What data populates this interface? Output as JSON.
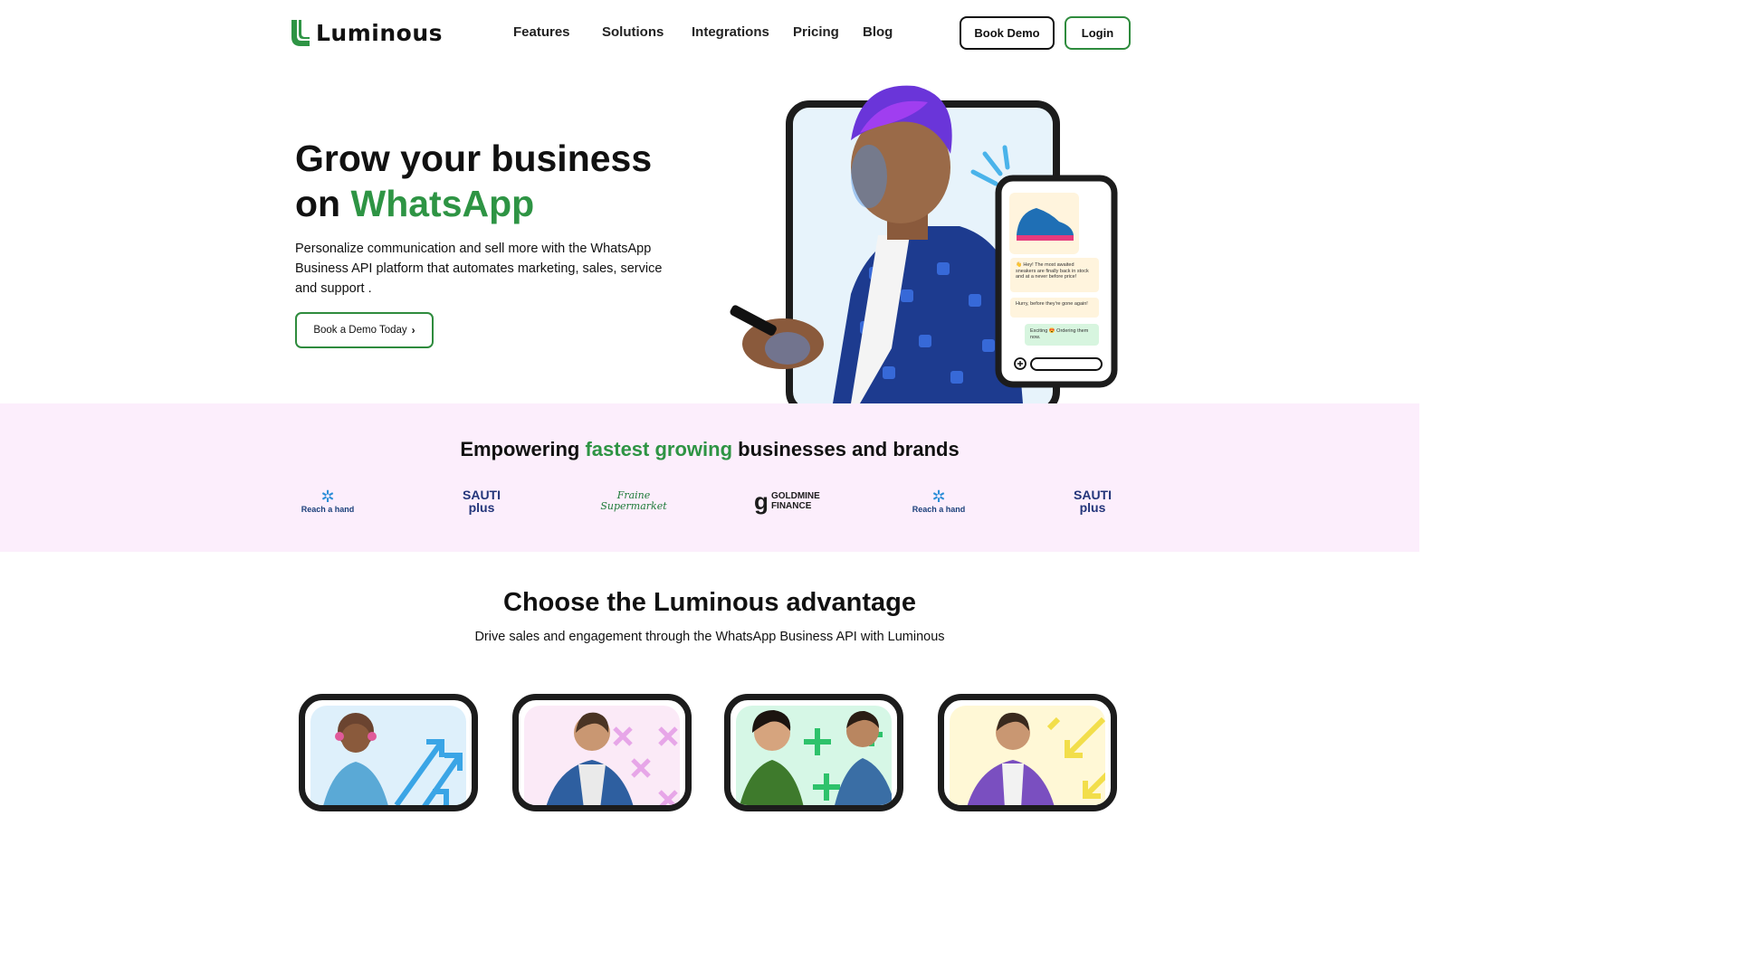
{
  "brand": {
    "name": "Luminous",
    "accent": "#2e9444"
  },
  "nav": {
    "links": [
      "Features",
      "Solutions",
      "Integrations",
      "Pricing",
      "Blog"
    ],
    "book_demo": "Book Demo",
    "login": "Login"
  },
  "hero": {
    "title_line1": "Grow your business",
    "title_on": "on",
    "title_highlight": "WhatsApp",
    "subtitle": "Personalize communication and sell more with the WhatsApp Business API platform that automates marketing, sales, service and support .",
    "cta": "Book a Demo Today",
    "chat": {
      "msg1": "👋 Hey! The most awaited sneakers are finally back in stock and at a never before price!",
      "msg2": "Hurry, before they're gone again!",
      "reply": "Exciting 😍 Ordering them now."
    }
  },
  "brands": {
    "title_pre": "Empowering",
    "title_highlight": "fastest growing",
    "title_post": "businesses and brands",
    "logos": [
      "Reach a hand",
      "SAUTI plus",
      "Fraine Supermarket",
      "GOLDMINE FINANCE",
      "Reach a hand",
      "SAUTI plus"
    ]
  },
  "advantage": {
    "title": "Choose the Luminous advantage",
    "subtitle": "Drive sales and engagement through the WhatsApp Business API with Luminous"
  }
}
